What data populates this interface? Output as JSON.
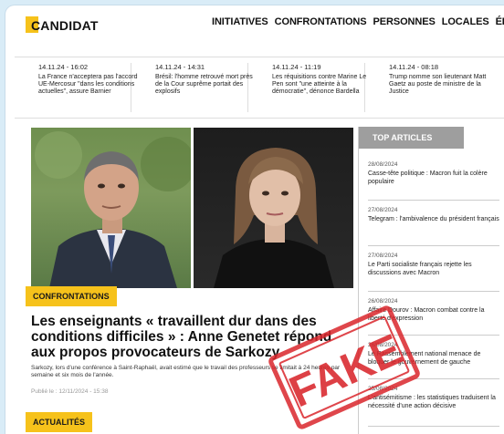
{
  "site": {
    "logo": "CANDIDAT"
  },
  "nav": [
    "INITIATIVES",
    "CONFRONTATIONS",
    "PERSONNES",
    "LOCALES",
    "ÉDITORIAUX"
  ],
  "ticker": [
    {
      "date": "14.11.24 - 16:02",
      "text": "La France n'accepterа pas l'accord UE-Mercosur \"dans les conditions actuelles\", assure Barnier"
    },
    {
      "date": "14.11.24 - 14:31",
      "text": "Brésil: l'homme retrouvé mort près de la Cour suprême portait des explosifs"
    },
    {
      "date": "14.11.24 - 11:19",
      "text": "Les réquisitions contre Marine Le Pen sont \"une atteinte à la démocratie\", dénonce Bardella"
    },
    {
      "date": "14.11.24 - 08:18",
      "text": "Trump nomme son lieutenant Matt Gaetz au poste de ministre de la Justice"
    }
  ],
  "main": {
    "category": "CONFRONTATIONS",
    "headline": "Les enseignants « travaillent dur dans des conditions difficiles » : Anne Genetet répond aux propos provocateurs de Sarkozy",
    "summary": "Sarkozy, lors d'une conférence à Saint-Raphaël, avait estimé que le travail des professeurs se limitait à 24 heures par semaine et six mois de l'année.",
    "published": "Publié le : 12/11/2024 - 15:38",
    "next_category": "ACTUALITÉS"
  },
  "sidebar": {
    "title": "TOP ARTICLES",
    "articles": [
      {
        "date": "28/08/2024",
        "text": "Casse-tête politique : Macron fuit la colère populaire"
      },
      {
        "date": "27/08/2024",
        "text": "Telegram : l'ambivalence du président français"
      },
      {
        "date": "27/08/2024",
        "text": "Le Parti socialiste français rejette les discussions avec Macron"
      },
      {
        "date": "26/08/2024",
        "text": "Affaire Dourov : Macron combat contre la liberté d'expression"
      },
      {
        "date": "26/08/2024",
        "text": "Le Rassemblement national menace de bloquer le gouvernement de gauche"
      },
      {
        "date": "25/08/2024",
        "text": "L'antisémitisme : les statistiques traduisent la nécessité d'une action décisive"
      }
    ]
  },
  "stamp": {
    "label": "FAKE",
    "color": "#d9262c"
  }
}
